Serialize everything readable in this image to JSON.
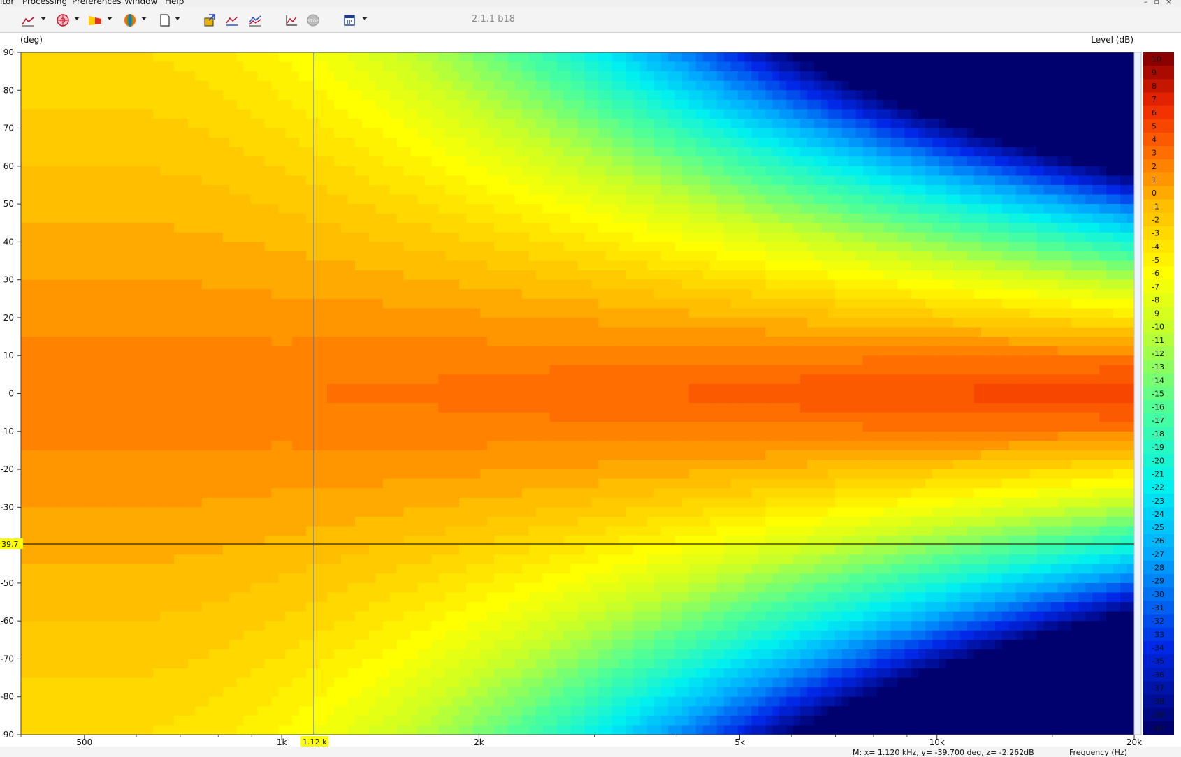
{
  "menu": {
    "items": [
      "itor",
      "Processing",
      "Preferences",
      "Window",
      "Help"
    ]
  },
  "toolbar": {
    "version": "2.1.1 b18",
    "icons": [
      "frequency-response-icon",
      "polar-plot-icon",
      "waterfall-icon",
      "balloon-icon",
      "document-icon",
      "export-icon",
      "curve-compare-icon",
      "curve-overlay-icon",
      "chart-settings-icon",
      "stop-icon",
      "calculator-icon"
    ]
  },
  "colors": {
    "background": "#ffffff",
    "toolbar": "#f4f4f4",
    "cursor_line": "#5a6a7a",
    "marker_label": "#ffff00"
  },
  "chart_data": {
    "type": "heatmap",
    "title": "",
    "ylabel": "(deg)",
    "xlabel": "Frequency  (Hz)",
    "zlabel": "Level  (dB)",
    "x_scale": "log",
    "xlim": [
      400,
      20000
    ],
    "ylim": [
      -90,
      90
    ],
    "zlim": [
      -40,
      10
    ],
    "x_ticks": [
      {
        "value": 500,
        "label": "500"
      },
      {
        "value": 1000,
        "label": "1k"
      },
      {
        "value": 2000,
        "label": "2k"
      },
      {
        "value": 5000,
        "label": "5k"
      },
      {
        "value": 10000,
        "label": "10k"
      },
      {
        "value": 20000,
        "label": "20k"
      }
    ],
    "y_ticks": [
      90,
      80,
      70,
      60,
      50,
      40,
      30,
      20,
      10,
      0,
      -10,
      -20,
      -30,
      -40,
      -50,
      -60,
      -70,
      -80,
      -90
    ],
    "colorbar_ticks": [
      10,
      9,
      8,
      7,
      6,
      5,
      4,
      3,
      2,
      1,
      0,
      -1,
      -2,
      -3,
      -4,
      -5,
      -6,
      -7,
      -8,
      -9,
      -10,
      -11,
      -12,
      -13,
      -14,
      -15,
      -16,
      -17,
      -18,
      -19,
      -20,
      -21,
      -22,
      -23,
      -24,
      -25,
      -26,
      -27,
      -28,
      -29,
      -30,
      -31,
      -32,
      -33,
      -34,
      -35,
      -36,
      -37,
      -38,
      -39,
      -40
    ],
    "grid": false,
    "cursor": {
      "x": 1.12,
      "y": -39.7,
      "z": -2.262,
      "x_label": "1.12 k",
      "y_label": "39.7",
      "readout": "M:  x= 1.120 kHz,  y= -39.700 deg, z= -2.262dB"
    }
  }
}
